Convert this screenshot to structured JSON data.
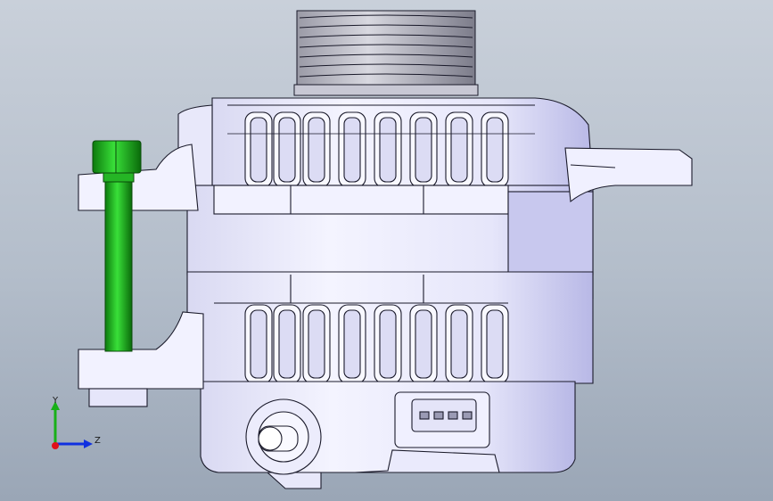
{
  "viewport": {
    "triad": {
      "x_axis_color": "#e0101a",
      "y_axis_color": "#18b018",
      "z_axis_color": "#1030e0",
      "y_label": "Y",
      "z_label": "Z"
    }
  },
  "model": {
    "body_color": "#e6e6fa",
    "edge_color": "#1a1a2a",
    "bolt_color": "#1fbf1f"
  }
}
